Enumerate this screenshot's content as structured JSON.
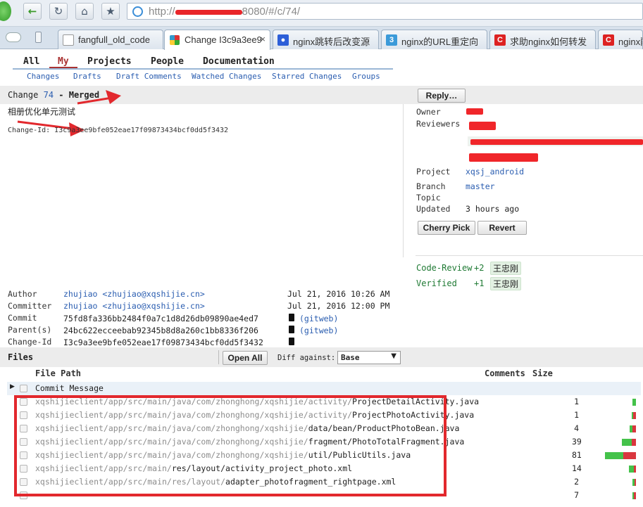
{
  "browser": {
    "address": "http://███.██.██.██:8080/#/c/74/",
    "address_prefix": "http://",
    "address_suffix": "8080/#/c/74/",
    "tabs": [
      {
        "label": "fangfull_old_code",
        "icon": "file-icon"
      },
      {
        "label": "Change I3c9a3ee9",
        "icon": "gerrit-icon",
        "active": true
      },
      {
        "label": "nginx跳转后改变源",
        "icon": "baidu-icon"
      },
      {
        "label": "nginx的URL重定向",
        "icon": "blog-icon"
      },
      {
        "label": "求助nginx如何转发",
        "icon": "csdn-icon"
      },
      {
        "label": "nginx配置",
        "icon": "csdn-icon"
      }
    ]
  },
  "menu": {
    "top": [
      "All",
      "My",
      "Projects",
      "People",
      "Documentation"
    ],
    "sub": [
      "Changes",
      "Drafts",
      "Draft Comments",
      "Watched Changes",
      "Starred Changes",
      "Groups"
    ]
  },
  "change": {
    "prefix": "Change",
    "number": "74",
    "status": "- Merged",
    "reply_label": "Reply…",
    "subject": "相册优化单元测试",
    "change_id_line": "Change-Id: I3c9a3ee9bfe052eae17f09873434bcf0dd5f3432"
  },
  "info": {
    "owner_label": "Owner",
    "reviewers_label": "Reviewers",
    "project_label": "Project",
    "project": "xqsj_android",
    "branch_label": "Branch",
    "branch": "master",
    "topic_label": "Topic",
    "updated_label": "Updated",
    "updated": "3 hours ago",
    "cherry_pick_label": "Cherry Pick",
    "revert_label": "Revert"
  },
  "votes": [
    {
      "label": "Code-Review",
      "value": "+2",
      "user": "王忠刚"
    },
    {
      "label": "Verified",
      "value": "+1",
      "user": "王忠刚"
    }
  ],
  "commit": {
    "author_label": "Author",
    "author": "zhujiao <zhujiao@xqshijie.cn>",
    "author_date": "Jul 21, 2016 10:26 AM",
    "committer_label": "Committer",
    "committer": "zhujiao <zhujiao@xqshijie.cn>",
    "committer_date": "Jul 21, 2016 12:00 PM",
    "commit_label": "Commit",
    "commit": "75fd8fa336bb2484f0a7c1d8d26db09890ae4ed7",
    "parent_label": "Parent(s)",
    "parent": "24bc622ecceebab92345b8d8a260c1bb8336f206",
    "changeid_label": "Change-Id",
    "changeid": "I3c9a3ee9bfe052eae17f09873434bcf0dd5f3432",
    "gitweb_label": "(gitweb)"
  },
  "files": {
    "title": "Files",
    "open_all_label": "Open All",
    "diff_against_label": "Diff against:",
    "diff_against_value": "Base",
    "col_file_path": "File Path",
    "col_comments": "Comments",
    "col_size": "Size",
    "commit_message_label": "Commit Message",
    "rows": [
      {
        "dim": "xqshijieclient/app/src/main/java/com/zhonghong/xqshijie/activity/",
        "name": "ProjectDetailActivity.java",
        "count": "1",
        "green": 5,
        "red": 0
      },
      {
        "dim": "xqshijieclient/app/src/main/java/com/zhonghong/xqshijie/activity/",
        "name": "ProjectPhotoActivity.java",
        "count": "1",
        "green": 2,
        "red": 4
      },
      {
        "dim": "xqshijieclient/app/src/main/java/com/zhonghong/xqshijie/",
        "name": "data/bean/ProductPhotoBean.java",
        "count": "4",
        "green": 4,
        "red": 5
      },
      {
        "dim": "xqshijieclient/app/src/main/java/com/zhonghong/xqshijie/",
        "name": "fragment/PhotoTotalFragment.java",
        "count": "39",
        "green": 14,
        "red": 6
      },
      {
        "dim": "xqshijieclient/app/src/main/java/com/zhonghong/xqshijie/",
        "name": "util/PublicUtils.java",
        "count": "81",
        "green": 26,
        "red": 18
      },
      {
        "dim": "xqshijieclient/app/src/main/",
        "name": "res/layout/activity_project_photo.xml",
        "count": "14",
        "green": 7,
        "red": 3
      },
      {
        "dim": "xqshijieclient/app/src/main/res/layout/",
        "name": "adapter_photofragment_rightpage.xml",
        "count": "2",
        "green": 3,
        "red": 2
      },
      {
        "dim": "",
        "name": "",
        "count": "7",
        "green": 2,
        "red": 3
      }
    ]
  },
  "colors": {
    "accent": "#2a5db0",
    "annotation": "#e2282d",
    "approve": "#1f7a34"
  }
}
